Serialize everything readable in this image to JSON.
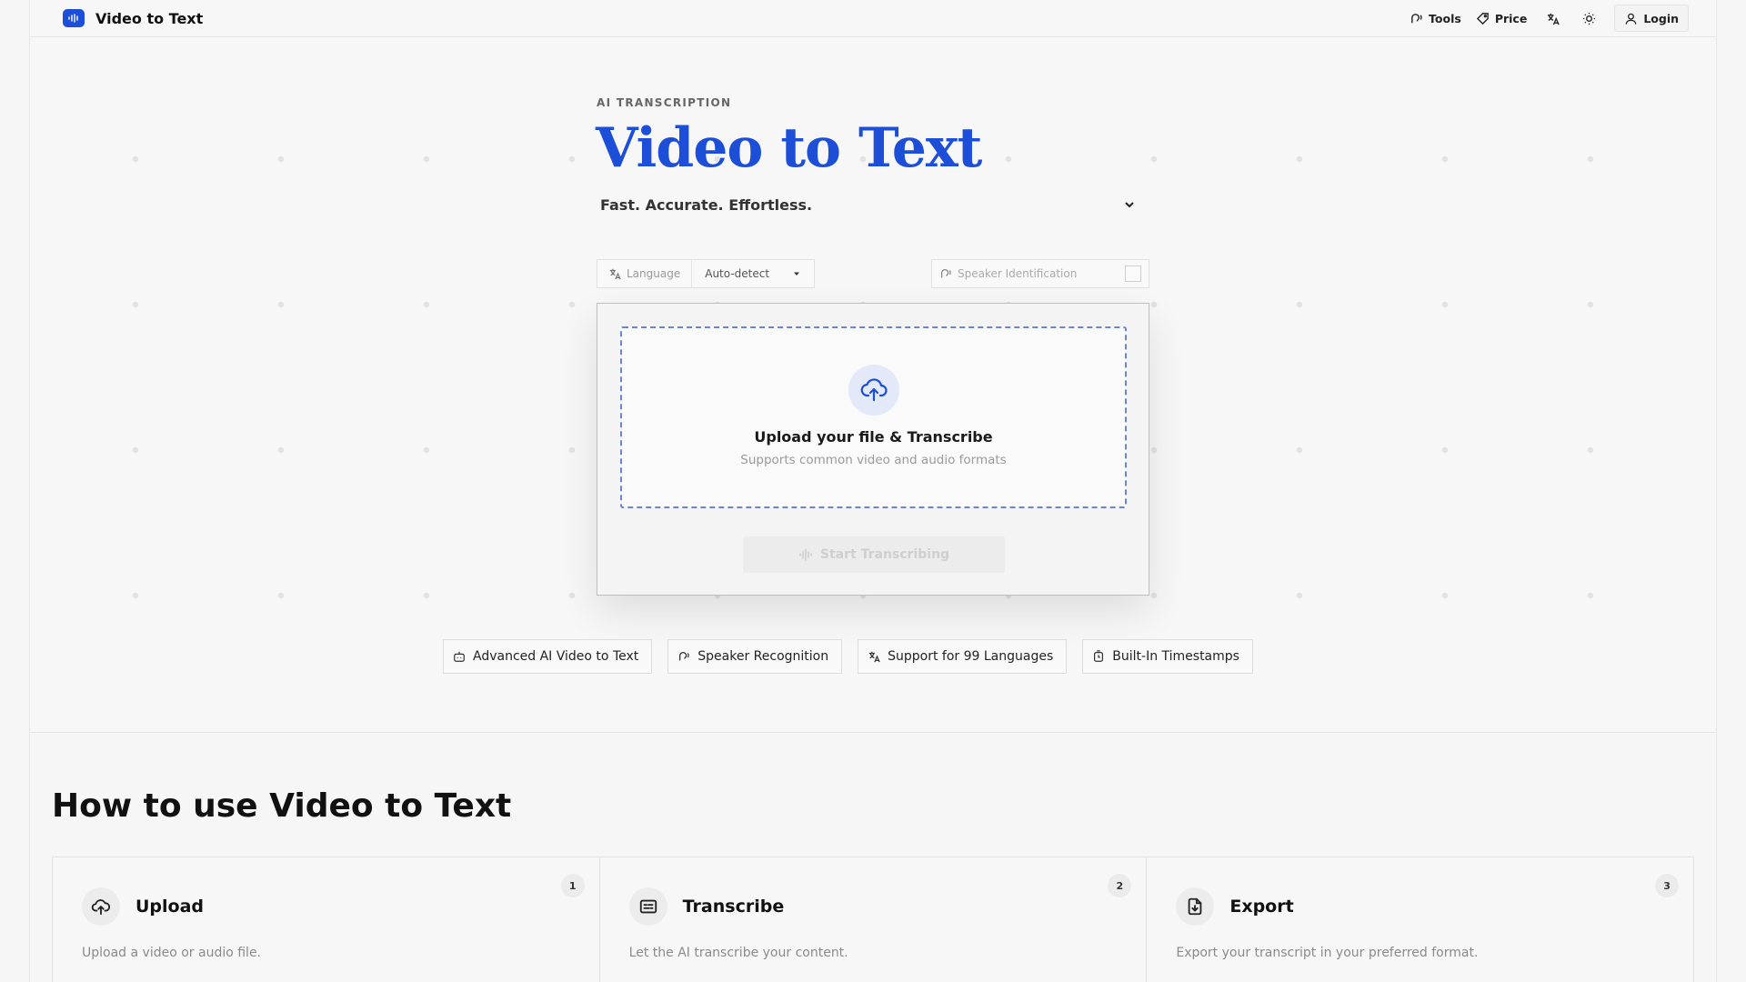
{
  "header": {
    "brand": "Video to Text",
    "nav": {
      "tools": "Tools",
      "price": "Price",
      "login": "Login"
    }
  },
  "hero": {
    "eyebrow": "AI TRANSCRIPTION",
    "title": "Video to Text",
    "tagline": "Fast. Accurate. Effortless."
  },
  "controls": {
    "language_label": "Language",
    "language_value": "Auto-detect",
    "speaker_label": "Speaker Identification"
  },
  "upload": {
    "title": "Upload your file & Transcribe",
    "subtitle": "Supports common video and audio formats",
    "start_button": "Start Transcribing"
  },
  "features": [
    {
      "label": "Advanced AI Video to Text",
      "icon": "bot-icon"
    },
    {
      "label": "Speaker Recognition",
      "icon": "speaker-icon"
    },
    {
      "label": "Support for 99 Languages",
      "icon": "translate-icon"
    },
    {
      "label": "Built-In Timestamps",
      "icon": "timer-icon"
    }
  ],
  "how": {
    "title": "How to use Video to Text",
    "steps": [
      {
        "number": "1",
        "title": "Upload",
        "desc": "Upload a video or audio file.",
        "icon": "upload-icon"
      },
      {
        "number": "2",
        "title": "Transcribe",
        "desc": "Let the AI transcribe your content.",
        "icon": "captions-icon"
      },
      {
        "number": "3",
        "title": "Export",
        "desc": "Export your transcript in your preferred format.",
        "icon": "file-download-icon"
      }
    ]
  },
  "colors": {
    "accent": "#1d4ed8",
    "dropzone_border": "#6b85d6"
  }
}
